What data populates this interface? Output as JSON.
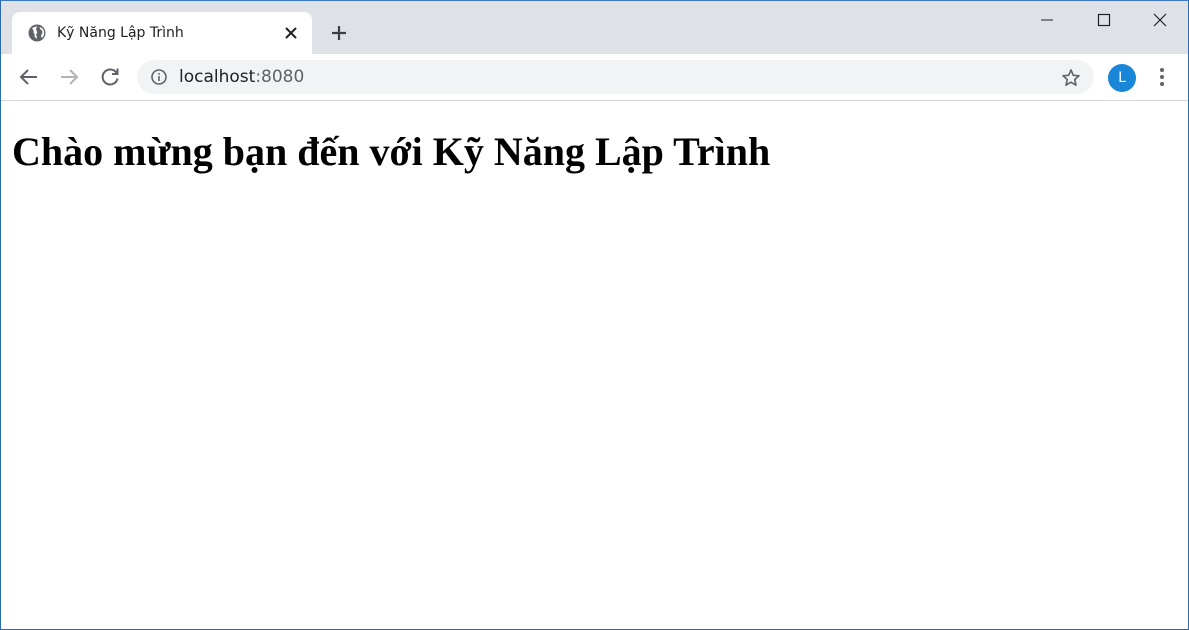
{
  "tab": {
    "title": "Kỹ Năng Lập Trình",
    "favicon": "globe-icon"
  },
  "address_bar": {
    "host": "localhost",
    "port": ":8080"
  },
  "profile": {
    "initial": "L",
    "color": "#1a86d8"
  },
  "page": {
    "heading": "Chào mừng bạn đến với Kỹ Năng Lập Trình"
  }
}
